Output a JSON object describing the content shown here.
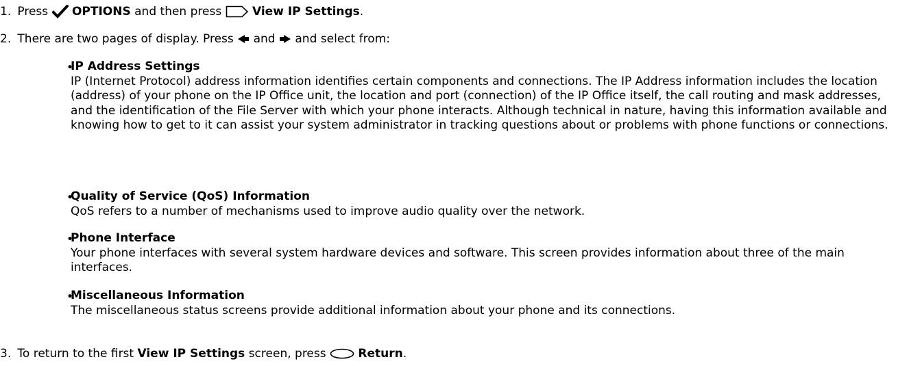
{
  "steps": [
    {
      "number": "1.",
      "text_1": "Press",
      "options_label": "OPTIONS",
      "text_2": "and then press",
      "view_label": "View IP Settings",
      "text_3": "."
    },
    {
      "number": "2.",
      "text_1": "There are two pages of display. Press",
      "text_2": "and",
      "text_3": "and select from:"
    },
    {
      "number": "3.",
      "text_1": "To return to the first",
      "view_label": "View IP Settings",
      "text_2": "screen, press",
      "return_label": "Return",
      "text_3": "."
    }
  ],
  "items": [
    {
      "bullet": "•",
      "title": "IP Address Settings",
      "description": "IP (Internet Protocol) address information identifies certain components and connections. The IP Address information includes the location (address) of your phone on the IP Office unit, the location and port (connection) of the IP Office itself, the call routing and mask addresses, and the identification of the File Server with which your phone interacts. Although technical in nature, having this information available and knowing how to get to it can assist your system administrator in tracking questions about or problems with phone functions or connections."
    },
    {
      "bullet": "•",
      "title": "Quality of Service (QoS) Information",
      "description": "QoS refers to a number of mechanisms used to improve audio quality over the network."
    },
    {
      "bullet": "•",
      "title": "Phone Interface",
      "description": "Your phone interfaces with several system hardware devices and software. This screen provides information about three of the main interfaces."
    },
    {
      "bullet": "•",
      "title": "Miscellaneous Information",
      "description": "The miscellaneous status screens provide additional information about your phone and its connections."
    }
  ],
  "icons": {
    "checkmark": "checkmark-icon",
    "softkey": "softkey-button-icon",
    "left_arrow": "left-arrow-icon",
    "right_arrow": "right-arrow-icon",
    "return_key": "oval-button-icon"
  }
}
